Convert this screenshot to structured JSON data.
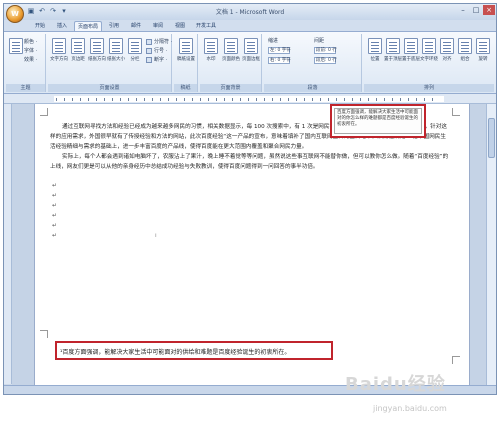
{
  "window": {
    "title": "文档 1 - Microsoft Word",
    "office_button": "W",
    "controls": [
      "–",
      "□",
      "×"
    ]
  },
  "quick_access": [
    "save-icon",
    "undo-icon",
    "redo-icon",
    "customize-icon"
  ],
  "tabs": [
    "开始",
    "插入",
    "页面布局",
    "引用",
    "邮件",
    "审阅",
    "视图",
    "开发工具"
  ],
  "active_tab_index": 2,
  "ribbon": {
    "groups": [
      {
        "label": "主题",
        "buttons": [
          "文字方向"
        ],
        "small": [
          "颜色 ·",
          "字体 ·",
          "效果 ·"
        ]
      },
      {
        "label": "页面设置",
        "buttons": [
          "文字方向",
          "页边距",
          "纸张方向",
          "纸张大小",
          "分栏"
        ],
        "small": [
          "分隔符 ·",
          "行号 ·",
          "断字 ·"
        ]
      },
      {
        "label": "稿纸",
        "buttons": [
          "稿纸设置"
        ],
        "small": []
      },
      {
        "label": "页面背景",
        "buttons": [
          "水印",
          "页面颜色",
          "页面边框"
        ],
        "small": []
      },
      {
        "label": "段落",
        "buttons": [],
        "small": [
          "缩进",
          "左: 0 字符",
          "右: 0 字符",
          "间距",
          "段前: 0 行",
          "段后: 0 行"
        ]
      },
      {
        "label": "排列",
        "buttons": [
          "位置",
          "置于顶层",
          "置于底层",
          "文字环绕",
          "对齐",
          "组合",
          "旋转"
        ],
        "small": []
      }
    ]
  },
  "document": {
    "paragraphs": [
      "通过互联网寻找方法和经验已经成为越来越多网民的习惯，相关数据显示，每 100 次搜索中，有 1 次是网民需要寻找方法类信息的问题解决的方法，针对这样的应用需求，外国很早就有了传授经验和方法的网站，此次百度经验“这一产品的宣布，意味着填补了国内互联网空白的空白地带，从而在满足 4 亿中国网民生活经验精细与需求的基础上，进一步丰富百度的产品线，使得百度能在更大范围内覆盖和聚合网民力量。",
      "实际上，每个人都会遇到诸如电脑坏了，农服沾上了果汁，晚上睡不着觉等等问题，虽然说这些事互联网不能替你做，但可以教你怎么做。随着“百度经验”的上线，网友们更是可以从他的亲身经历中总结成功经验与失败教训，使得百度问题得到一问回答的事半功倍。"
    ],
    "callout_text": "百度方面强调，能解决大家生活中可能面对的你怎么样的难题都是百度经验诞生的初衷所在。",
    "footnote_text": "¹百度方面强调，能解决大家生活中可能面对的供给和难题是百度经验诞生的初衷所在。",
    "paragraph_marks": 6
  },
  "statusbar": {
    "text": ""
  },
  "watermark": {
    "brand": "Baidu经验",
    "url": "jingyan.baidu.com"
  }
}
